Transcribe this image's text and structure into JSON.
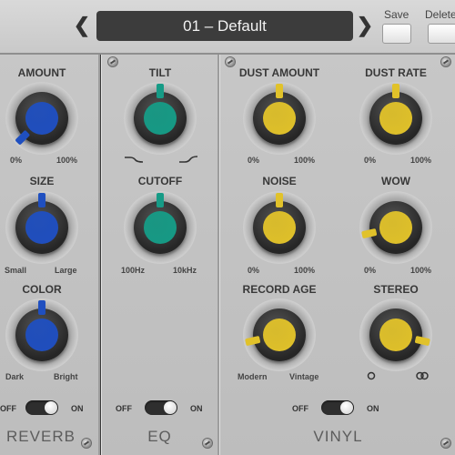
{
  "preset": {
    "name": "01 – Default",
    "prev_icon": "chevron-left-icon",
    "next_icon": "chevron-right-icon"
  },
  "toolbar": {
    "save_label": "Save",
    "delete_label": "Delete"
  },
  "colors": {
    "reverb": "#1f4fc0",
    "eq": "#169b86",
    "vinyl": "#e1c22a"
  },
  "reverb": {
    "title": "REVERB",
    "knobs": [
      {
        "label": "AMOUNT",
        "min_label": "0%",
        "max_label": "100%",
        "level": 0.0
      },
      {
        "label": "SIZE",
        "min_label": "Small",
        "max_label": "Large",
        "level": 0.5
      },
      {
        "label": "COLOR",
        "min_label": "Dark",
        "max_label": "Bright",
        "level": 0.5
      }
    ],
    "toggle": {
      "off_label": "OFF",
      "on_label": "ON",
      "state": "on"
    }
  },
  "eq": {
    "title": "EQ",
    "knobs": [
      {
        "label": "TILT",
        "min_icon": "tilt-low-icon",
        "max_icon": "tilt-high-icon",
        "level": 0.5
      },
      {
        "label": "CUTOFF",
        "min_label": "100Hz",
        "max_label": "10kHz",
        "level": 0.5
      }
    ],
    "toggle": {
      "off_label": "OFF",
      "on_label": "ON",
      "state": "on"
    }
  },
  "vinyl": {
    "title": "VINYL",
    "knobs": [
      {
        "label": "DUST AMOUNT",
        "min_label": "0%",
        "max_label": "100%",
        "level": 0.5
      },
      {
        "label": "DUST RATE",
        "min_label": "0%",
        "max_label": "100%",
        "level": 0.5
      },
      {
        "label": "NOISE",
        "min_label": "0%",
        "max_label": "100%",
        "level": 0.5
      },
      {
        "label": "WOW",
        "min_label": "0%",
        "max_label": "100%",
        "level": 0.12
      },
      {
        "label": "RECORD AGE",
        "min_label": "Modern",
        "max_label": "Vintage",
        "level": 0.12
      },
      {
        "label": "STEREO",
        "min_icon": "mono-icon",
        "max_icon": "stereo-icon",
        "level": 0.88
      }
    ],
    "toggle": {
      "off_label": "OFF",
      "on_label": "ON",
      "state": "on"
    }
  }
}
